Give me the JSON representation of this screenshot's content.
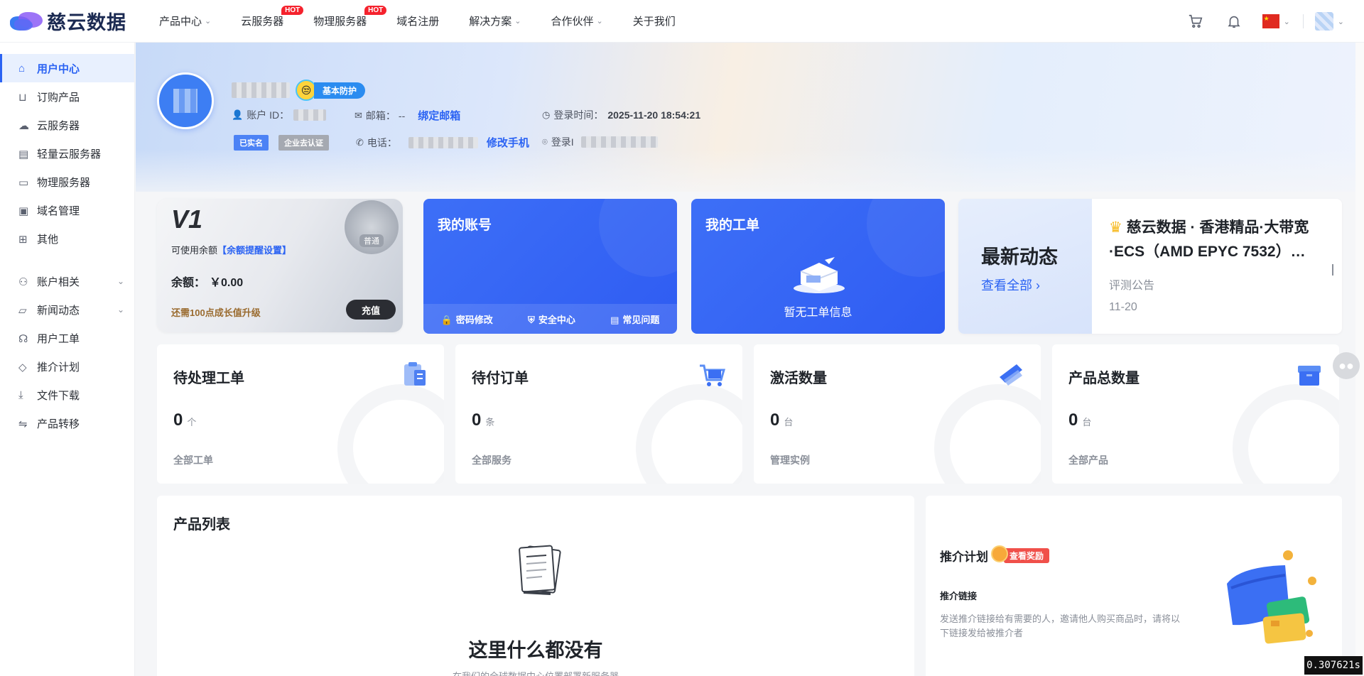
{
  "brand": {
    "name": "慈云数据"
  },
  "topnav": {
    "items": [
      {
        "label": "产品中心",
        "hot": false,
        "dropdown": true
      },
      {
        "label": "云服务器",
        "hot": true,
        "dropdown": false
      },
      {
        "label": "物理服务器",
        "hot": true,
        "dropdown": false
      },
      {
        "label": "域名注册",
        "hot": false,
        "dropdown": false
      },
      {
        "label": "解决方案",
        "hot": false,
        "dropdown": true
      },
      {
        "label": "合作伙伴",
        "hot": false,
        "dropdown": true
      },
      {
        "label": "关于我们",
        "hot": false,
        "dropdown": false
      }
    ],
    "hot_label": "HOT",
    "icons": [
      "cart-icon",
      "bell-icon",
      "flag-cn-icon",
      "user-avatar"
    ]
  },
  "sidebar": {
    "items": [
      {
        "label": "用户中心",
        "icon": "home-icon",
        "active": true
      },
      {
        "label": "订购产品",
        "icon": "cart-icon"
      },
      {
        "label": "云服务器",
        "icon": "cloud-icon"
      },
      {
        "label": "轻量云服务器",
        "icon": "server-icon"
      },
      {
        "label": "物理服务器",
        "icon": "drive-icon"
      },
      {
        "label": "域名管理",
        "icon": "domain-icon"
      },
      {
        "label": "其他",
        "icon": "grid-icon"
      }
    ],
    "groups": [
      {
        "label": "账户相关",
        "icon": "user-group-icon",
        "expandable": true
      },
      {
        "label": "新闻动态",
        "icon": "folder-icon",
        "expandable": true
      },
      {
        "label": "用户工单",
        "icon": "headset-icon"
      },
      {
        "label": "推介计划",
        "icon": "diamond-icon"
      },
      {
        "label": "文件下载",
        "icon": "download-icon"
      },
      {
        "label": "产品转移",
        "icon": "transfer-icon"
      }
    ]
  },
  "profile": {
    "protect_tag": "基本防护",
    "account_id_label": "账户 ID：",
    "email_label": "邮箱：",
    "email_value": "--",
    "bind_email": "绑定邮箱",
    "login_time_label": "登录时间：",
    "login_time": "2025-11-20 18:54:21",
    "tag_verified": "已实名",
    "tag_enterprise": "企业去认证",
    "phone_label": "电话：",
    "change_phone": "修改手机",
    "login_ip_label": "登录I"
  },
  "vip": {
    "level": "V1",
    "balance_label": "可使用余额",
    "balance_setting": "【余额提醒设置】",
    "balance_text": "余额：",
    "balance_value": "￥0.00",
    "upgrade_hint": "还需100点成长值升级",
    "medal_label": "普通",
    "recharge": "充值"
  },
  "account_card": {
    "title": "我的账号",
    "links": [
      "密码修改",
      "安全中心",
      "常见问题"
    ]
  },
  "ticket_card": {
    "title": "我的工单",
    "empty": "暂无工单信息"
  },
  "news": {
    "title": "最新动态",
    "more": "查看全部 ›",
    "headline": "慈云数据 · 香港精品·大带宽·ECS（AMD EPYC 7532）…",
    "category": "评测公告",
    "date": "11-20"
  },
  "stats": [
    {
      "label": "待处理工单",
      "value": "0",
      "unit": "个",
      "footer": "全部工单",
      "icon": "clipboard-icon"
    },
    {
      "label": "待付订单",
      "value": "0",
      "unit": "条",
      "footer": "全部服务",
      "icon": "shopping-cart-icon"
    },
    {
      "label": "激活数量",
      "value": "0",
      "unit": "台",
      "footer": "管理实例",
      "icon": "activate-icon"
    },
    {
      "label": "产品总数量",
      "value": "0",
      "unit": "台",
      "footer": "全部产品",
      "icon": "box-icon"
    }
  ],
  "product_list": {
    "title": "产品列表",
    "empty_title": "这里什么都没有",
    "empty_sub": "在我们的全球数据中心位置部署新服务器"
  },
  "referral": {
    "title": "推介计划",
    "badge": "查看奖励",
    "sub": "推介链接",
    "desc": "发送推介链接给有需要的人，邀请他人购买商品时，请将以下链接发给被推介者"
  },
  "timer": "0.307621s",
  "colors": {
    "accent": "#2b63f3",
    "hot": "#f5222d",
    "card_blue": "#3465f4"
  }
}
